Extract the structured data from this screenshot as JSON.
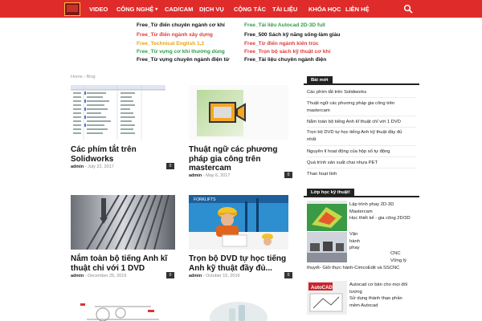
{
  "nav": {
    "items": [
      {
        "label": "VIDEO",
        "dropdown": false
      },
      {
        "label": "CÔNG NGHỆ",
        "dropdown": true
      },
      {
        "label": "CAD/CAM",
        "dropdown": false
      },
      {
        "label": "DỊCH VỤ",
        "dropdown": false
      },
      {
        "label": "CỘNG TÁC",
        "dropdown": false
      },
      {
        "label": "TÀI LIỆU",
        "dropdown": false
      },
      {
        "label": "KHÓA HỌC",
        "dropdown": false
      },
      {
        "label": "LIÊN HỆ",
        "dropdown": false
      }
    ],
    "search_icon": "search-icon",
    "dropdown_glyph": "▾"
  },
  "promo": {
    "left": [
      {
        "label": "Free_Từ điển chuyên ngành cơ khí",
        "color": "#111111"
      },
      {
        "label": "Free_Từ điển ngành xây dựng",
        "color": "#e03a3a"
      },
      {
        "label": "Free_Technical English 1,2",
        "color": "#e7a21a"
      },
      {
        "label": "Free_Từ vựng cơ khí thường dùng",
        "color": "#2e9e4a"
      },
      {
        "label": "Free_Từ vựng chuyên ngành điện tử",
        "color": "#111111"
      }
    ],
    "right": [
      {
        "label": "Free_Tài liệu Autocad 2D-3D full",
        "color": "#2e9e4a"
      },
      {
        "label": "Free_500 Sách kỹ năng sống-làm giàu",
        "color": "#111111"
      },
      {
        "label": "Free_Từ điển ngành kiến trúc",
        "color": "#e03a3a"
      },
      {
        "label": "Free_Trọn bộ sách kỹ thuật cơ khí",
        "color": "#e03a3a"
      },
      {
        "label": "Free_Tài liệu chuyên ngành điện",
        "color": "#111111"
      }
    ]
  },
  "breadcrumb": {
    "home": "Home",
    "sep": "›",
    "current": "Blog"
  },
  "posts": [
    {
      "title_l1": "Các phím tắt trên",
      "title_l2": "Solidworks",
      "title_l3": "",
      "author": "admin",
      "dash": "-",
      "date": "July 22, 2017",
      "comments": "0"
    },
    {
      "title_l1": "Thuật ngữ các phương",
      "title_l2": "pháp gia công trên",
      "title_l3": "mastercam",
      "author": "admin",
      "dash": "-",
      "date": "May 6, 2017",
      "comments": "0"
    },
    {
      "title_l1": "Nắm toàn bộ tiếng Anh kĩ",
      "title_l2": "thuật chỉ với 1 DVD",
      "title_l3": "",
      "author": "admin",
      "dash": "-",
      "date": "December 25, 2016",
      "comments": "0"
    },
    {
      "title_l1": "Trọn bộ DVD tự học tiếng",
      "title_l2": "Anh kỹ thuật đầy đủ...",
      "title_l3": "",
      "author": "admin",
      "dash": "-",
      "date": "October 15, 2016",
      "comments": "0"
    }
  ],
  "sidebar": {
    "recent_heading": "Bài mới",
    "recent": [
      {
        "l1": "Các phím tắt trên Solidworks",
        "l2": ""
      },
      {
        "l1": "Thuật ngữ các phương pháp gia công trên",
        "l2": "mastercam"
      },
      {
        "l1": "Nắm toàn bộ tiếng Anh kĩ thuật chỉ với 1 DVD",
        "l2": ""
      },
      {
        "l1": "Trọn bộ DVD tự học tiếng Anh kỹ thuật đầy đủ",
        "l2": "nhất"
      },
      {
        "l1": "Nguyên lí hoạt động của hộp số tự động",
        "l2": ""
      },
      {
        "l1": "Quá trình sản xuất chai nhựa PET",
        "l2": ""
      },
      {
        "l1": "Than hoạt tính",
        "l2": ""
      }
    ],
    "courses_heading": "Lớp học kỹ thuật!",
    "courses": {
      "c1_l1": "Lập trình phay 2D-3D",
      "c1_l2": "Mastercam",
      "c1_l3": "Học thiết kế - gia công 2D/3D",
      "c2_l1": "Vận",
      "c2_l2": "hành",
      "c2_l3": "phay",
      "c2_l4": "CNC",
      "c2_l5": "Vững lý",
      "c2_l6": "thuyết- Giỏi thực hành-CimcoEdit và SSCNC",
      "c3_l1": "Autocad cơ bản cho mọi đối",
      "c3_l2": "tượng",
      "c3_l3": "Sử dụng thành thạo phần",
      "c3_l4": "mềm Autocad"
    }
  },
  "colors": {
    "brand_red": "#e02b2b",
    "dark": "#222222",
    "muted": "#888888"
  }
}
